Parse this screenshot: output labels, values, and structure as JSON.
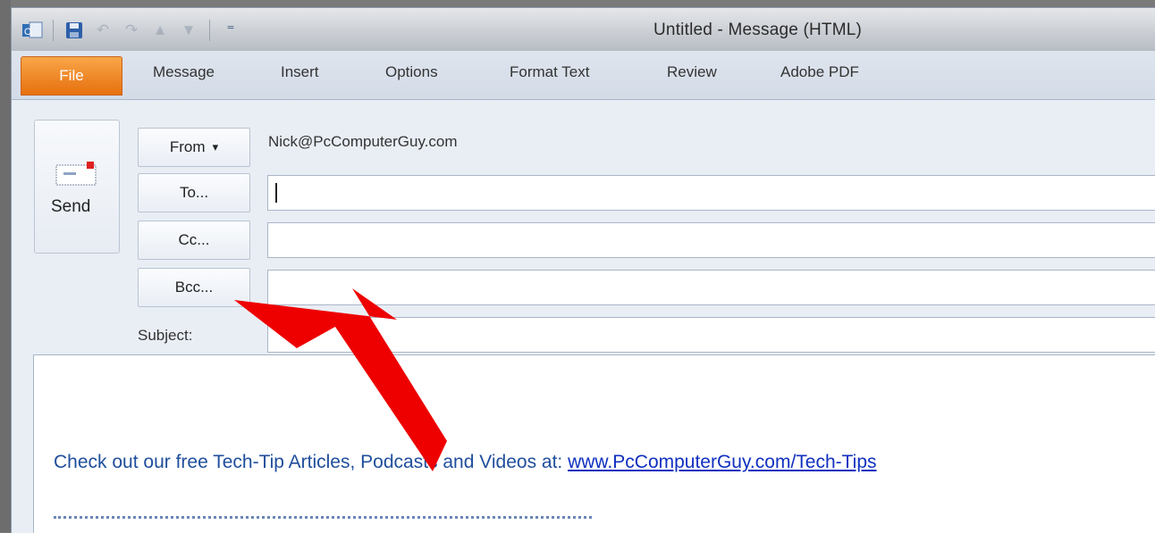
{
  "window": {
    "title": "Untitled - Message (HTML)"
  },
  "quick_access": {
    "icons": [
      "outlook-icon",
      "save-icon",
      "undo-icon",
      "redo-icon",
      "up-arrow-icon",
      "down-arrow-icon",
      "customize-icon"
    ]
  },
  "ribbon": {
    "tabs": [
      "File",
      "Message",
      "Insert",
      "Options",
      "Format Text",
      "Review",
      "Adobe PDF"
    ]
  },
  "header": {
    "send_label": "Send",
    "from_label": "From",
    "from_caret": "▾",
    "from_value": "Nick@PcComputerGuy.com",
    "to_label": "To...",
    "cc_label": "Cc...",
    "bcc_label": "Bcc...",
    "subject_label": "Subject:",
    "to_value": "",
    "cc_value": "",
    "bcc_value": "",
    "subject_value": ""
  },
  "body": {
    "signature_text": "Check out our free Tech-Tip Articles, Podcasts and Videos at: ",
    "signature_link": "www.PcComputerGuy.com/Tech-Tips"
  },
  "colors": {
    "file_tab": "#e7700e",
    "link": "#1030c0",
    "arrow": "#ee0000"
  }
}
